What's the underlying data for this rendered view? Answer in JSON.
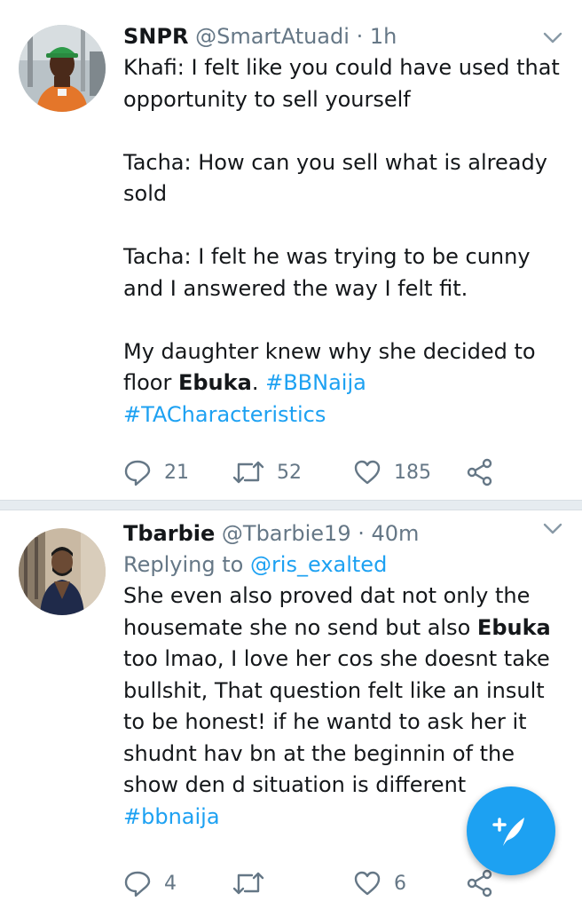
{
  "tweets": [
    {
      "name": "SNPR",
      "handle": "@SmartAtuadi",
      "separator": "·",
      "time": "1h",
      "body": {
        "p1": "Khafi: I felt like you could have used that opportunity to sell yourself",
        "p2": "Tacha: How can you sell what is already sold",
        "p3": "Tacha: I felt he was trying to be cunny and I answered the way I felt fit.",
        "p4_text": "My daughter knew why she decided to floor ",
        "p4_bold": "Ebuka",
        "p4_end": ". ",
        "hashtag1": "#BBNaija",
        "hashtag2": "#TACharacteristics"
      },
      "stats": {
        "replies": "21",
        "retweets": "52",
        "likes": "185"
      }
    },
    {
      "name": "Tbarbie",
      "handle": "@Tbarbie19",
      "separator": "·",
      "time": "40m",
      "replying_label": "Replying to ",
      "replying_to": "@ris_exalted",
      "body": {
        "text1": "She even also proved dat not only the housemate she no send but also ",
        "bold": "Ebuka",
        "text2": " too lmao, I love her cos she doesnt take bullshit, That question felt like an insult to be honest! if he wantd to ask her it shudnt hav bn at the beginnin of the show den d situation is different",
        "hashtag": "#bbnaija"
      },
      "stats": {
        "replies": "4",
        "retweets": "",
        "likes": "6"
      }
    }
  ],
  "icons": {
    "reply": "reply-icon",
    "retweet": "retweet-icon",
    "like": "heart-icon",
    "share": "share-icon",
    "menu": "chevron-down-icon",
    "compose": "compose-tweet-icon"
  },
  "colors": {
    "accent": "#1da1f2",
    "text": "#14171a",
    "secondary": "#657786",
    "divider": "#e6ecf0"
  }
}
